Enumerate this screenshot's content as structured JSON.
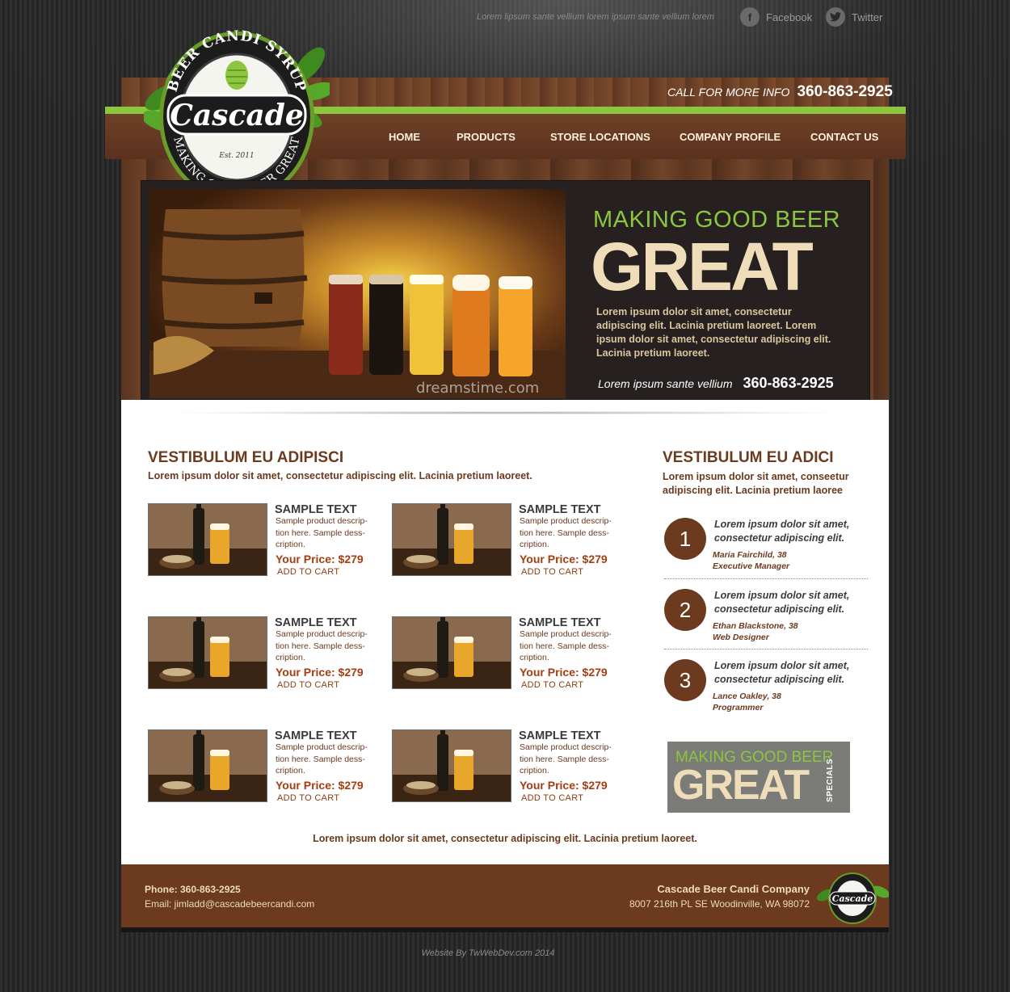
{
  "top_bar": {
    "tagline": "Lorem lipsum sante vellium lorem ipsum sante vellium lorem",
    "facebook": {
      "icon": "f",
      "label": "Facebook"
    },
    "twitter": {
      "icon": "t",
      "label": "Twitter"
    }
  },
  "logo": {
    "top_arc": "BEER CANDI SYRUP",
    "name": "Cascade",
    "est": "Est. 2011",
    "bottom_arc": "MAKING GOOD BEER GREAT"
  },
  "header": {
    "call_label": "CALL FOR MORE INFO",
    "phone": "360-863-2925"
  },
  "nav": {
    "items": [
      {
        "label": "HOME"
      },
      {
        "label": "PRODUCTS"
      },
      {
        "label": "STORE LOCATIONS"
      },
      {
        "label": "COMPANY PROFILE"
      },
      {
        "label": "CONTACT US"
      }
    ]
  },
  "hero": {
    "image_watermark": "dreamstime.com",
    "subtitle": "MAKING GOOD BEER",
    "title": "GREAT",
    "text": "Lorem ipsum dolor sit amet, consectetur adipiscing elit. Lacinia pretium laoreet. Lorem ipsum dolor sit amet, consectetur adipiscing elit. Lacinia pretium laoreet.",
    "contact_label": "Lorem ipsum sante vellium",
    "phone": "360-863-2925"
  },
  "main": {
    "heading": "VESTIBULUM EU ADIPISCI",
    "subheading": "Lorem ipsum dolor sit amet, consectetur adipiscing elit. Lacinia pretium laoreet.",
    "products": [
      {
        "title": "SAMPLE TEXT",
        "description": "Sample product descrip-tion here. Sample dess-cription.",
        "price": "Your Price: $279",
        "cart": "ADD TO CART"
      },
      {
        "title": "SAMPLE TEXT",
        "description": "Sample product descrip-tion here. Sample dess-cription.",
        "price": "Your Price: $279",
        "cart": "ADD TO CART"
      },
      {
        "title": "SAMPLE TEXT",
        "description": "Sample product descrip-tion here. Sample dess-cription.",
        "price": "Your Price: $279",
        "cart": "ADD TO CART"
      },
      {
        "title": "SAMPLE TEXT",
        "description": "Sample product descrip-tion here. Sample dess-cription.",
        "price": "Your Price: $279",
        "cart": "ADD TO CART"
      },
      {
        "title": "SAMPLE TEXT",
        "description": "Sample product descrip-tion here. Sample dess-cription.",
        "price": "Your Price: $279",
        "cart": "ADD TO CART"
      },
      {
        "title": "SAMPLE TEXT",
        "description": "Sample product descrip-tion here. Sample dess-cription.",
        "price": "Your Price: $279",
        "cart": "ADD TO CART"
      }
    ],
    "bottom_text": "Lorem ipsum dolor sit amet, consectetur adipiscing elit. Lacinia pretium laoreet."
  },
  "sidebar": {
    "heading": "VESTIBULUM EU ADICI",
    "subheading": "Lorem ipsum dolor sit amet, conseetur adipiscing elit. Lacinia pretium laoree",
    "testimonials": [
      {
        "number": "1",
        "quote": "Lorem ipsum dolor sit amet, consectetur adipiscing elit.",
        "name": "Maria Fairchild, 38",
        "role": "Executive Manager"
      },
      {
        "number": "2",
        "quote": "Lorem ipsum dolor sit amet, consectetur adipiscing elit.",
        "name": "Ethan Blackstone, 38",
        "role": "Web Designer"
      },
      {
        "number": "3",
        "quote": "Lorem ipsum dolor sit amet, consectetur adipiscing elit.",
        "name": "Lance Oakley, 38",
        "role": "Programmer"
      }
    ],
    "promo": {
      "line1": "MAKING GOOD BEER",
      "line2": "GREAT",
      "side": "SPECIALS"
    }
  },
  "footer": {
    "phone": "Phone: 360-863-2925",
    "email": "Email: jimladd@cascadebeercandi.com",
    "company": "Cascade Beer Candi Company",
    "address": "8007 216th PL SE Woodinville, WA 98072"
  },
  "credit": "Website By TwWebDev.com 2014",
  "colors": {
    "brown": "#6b3a1f",
    "green": "#8cc63f",
    "cream": "#efdcb8",
    "price": "#a43e12"
  }
}
